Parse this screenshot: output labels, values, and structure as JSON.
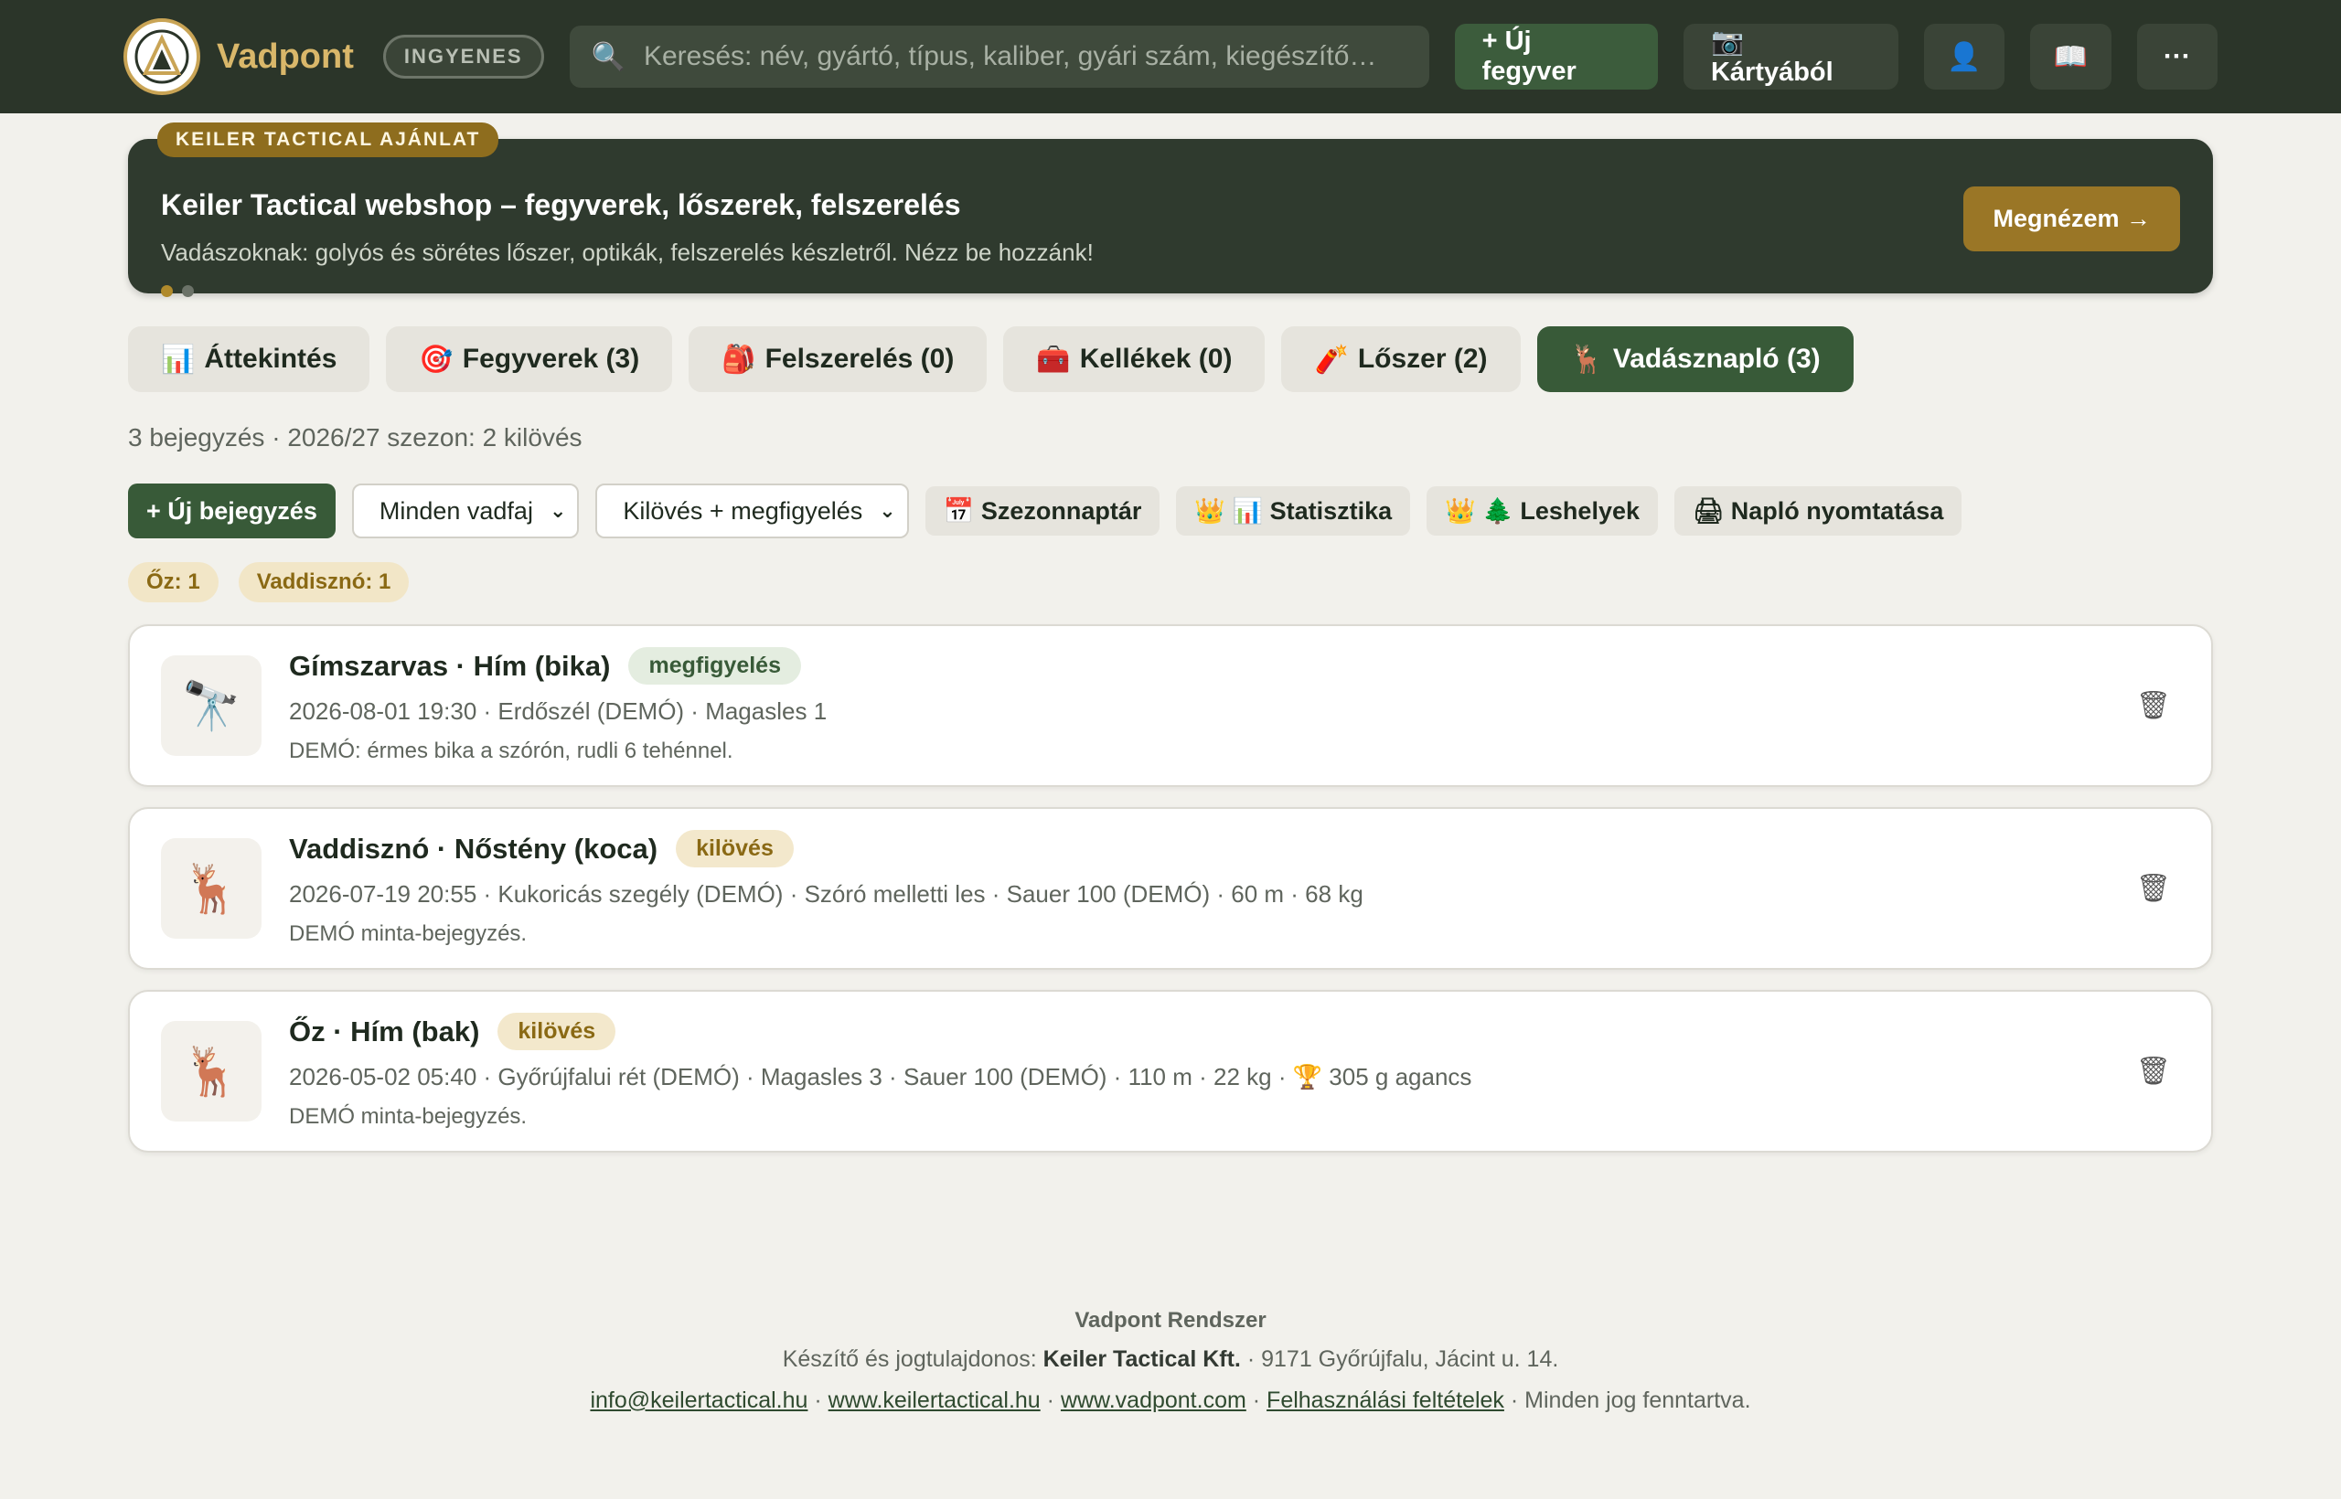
{
  "header": {
    "brand": "Vadpont",
    "plan_badge": "INGYENES",
    "search_placeholder": "Keresés: név, gyártó, típus, kaliber, gyári szám, kiegészítő…",
    "new_weapon": "+ Új fegyver",
    "from_card": "📷 Kártyából",
    "profile_icon": "👤",
    "manual_icon": "📖",
    "more_icon": "···"
  },
  "promo": {
    "tag": "KEILER TACTICAL AJÁNLAT",
    "title": "Keiler Tactical webshop – fegyverek, lőszerek, felszerelés",
    "description": "Vadászoknak: golyós és sörétes lőszer, optikák, felszerelés készletről. Nézz be hozzánk!",
    "cta": "Megnézem →"
  },
  "tabs": [
    {
      "icon": "📊",
      "label": "Áttekintés"
    },
    {
      "icon": "🎯",
      "label": "Fegyverek (3)"
    },
    {
      "icon": "🎒",
      "label": "Felszerelés (0)"
    },
    {
      "icon": "🧰",
      "label": "Kellékek (0)"
    },
    {
      "icon": "🧨",
      "label": "Lőszer (2)"
    },
    {
      "icon": "🦌",
      "label": "Vadásznapló (3)"
    }
  ],
  "summary": "3 bejegyzés · 2026/27 szezon: 2 kilövés",
  "actions": {
    "new_entry": "+ Új bejegyzés",
    "species_filter": "Minden vadfaj",
    "type_filter": "Kilövés + megfigyelés",
    "season_calendar": "📅 Szezonnaptár",
    "statistics": "👑 📊 Statisztika",
    "stands": "👑 🌲 Leshelyek",
    "print_log": "🖨 Napló nyomtatása"
  },
  "chips": [
    "Őz: 1",
    "Vaddisznó: 1"
  ],
  "entries": [
    {
      "icon": "🔭",
      "title": "Gímszarvas · Hím (bika)",
      "badge": "megfigyelés",
      "meta": "2026-08-01 19:30 · Erdőszél (DEMÓ) · Magasles 1",
      "note": "DEMÓ: érmes bika a szórón, rudli 6 tehénnel."
    },
    {
      "icon": "🦌",
      "title": "Vaddisznó · Nőstény (koca)",
      "badge": "kilövés",
      "meta": "2026-07-19 20:55 · Kukoricás szegély (DEMÓ) · Szóró melletti les · Sauer 100 (DEMÓ) · 60 m · 68 kg",
      "note": "DEMÓ minta-bejegyzés."
    },
    {
      "icon": "🦌",
      "title": "Őz · Hím (bak)",
      "badge": "kilövés",
      "meta": "2026-05-02 05:40 · Győrújfalui rét (DEMÓ) · Magasles 3 · Sauer 100 (DEMÓ) · 110 m · 22 kg · 🏆 305 g agancs",
      "note": "DEMÓ minta-bejegyzés."
    }
  ],
  "footer": {
    "title": "Vadpont Rendszer",
    "owner_prefix": "Készítő és jogtulajdonos:",
    "owner_name": "Keiler Tactical Kft.",
    "owner_address": "· 9171 Győrújfalu, Jácint u. 14.",
    "links": [
      "info@keilertactical.hu",
      "www.keilertactical.hu",
      "www.vadpont.com",
      "Felhasználási feltételek"
    ],
    "rights": "Minden jog fenntartva."
  }
}
